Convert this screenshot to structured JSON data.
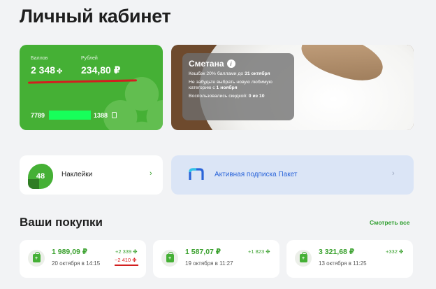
{
  "page": {
    "title": "Личный кабинет"
  },
  "loyalty": {
    "points_label": "Баллов",
    "points_value": "2 348",
    "points_icon": "✤",
    "rubles_label": "Рублей",
    "rubles_value": "234,80 ₽",
    "card_prefix": "7789",
    "card_suffix": "1388",
    "brand_color": "#45b035"
  },
  "promo": {
    "title": "Сметана",
    "line1": "Кешбэк 20% баллами до",
    "line1_bold": "31 октября",
    "line2": "Не забудьте выбрать новую любимую категорию с",
    "line2_bold": "1 ноября",
    "line3": "Воспользовались скидкой:",
    "line3_bold": "0 из 10"
  },
  "stickers": {
    "count": "48",
    "label": "Наклейки"
  },
  "subscription": {
    "label": "Активная подписка Пакет",
    "accent_color": "#2a64d9"
  },
  "purchases": {
    "title": "Ваши покупки",
    "see_all": "Смотреть все",
    "items": [
      {
        "amount": "1 989,09 ₽",
        "date": "20 октября в 14:15",
        "earned": "+2 339 ✤",
        "spent": "−2 410 ✤"
      },
      {
        "amount": "1 587,07 ₽",
        "date": "19 октября в 11:27",
        "earned": "+1 823 ✤"
      },
      {
        "amount": "3 321,68 ₽",
        "date": "13 октября в 11:25",
        "earned": "+332 ✤"
      }
    ]
  }
}
